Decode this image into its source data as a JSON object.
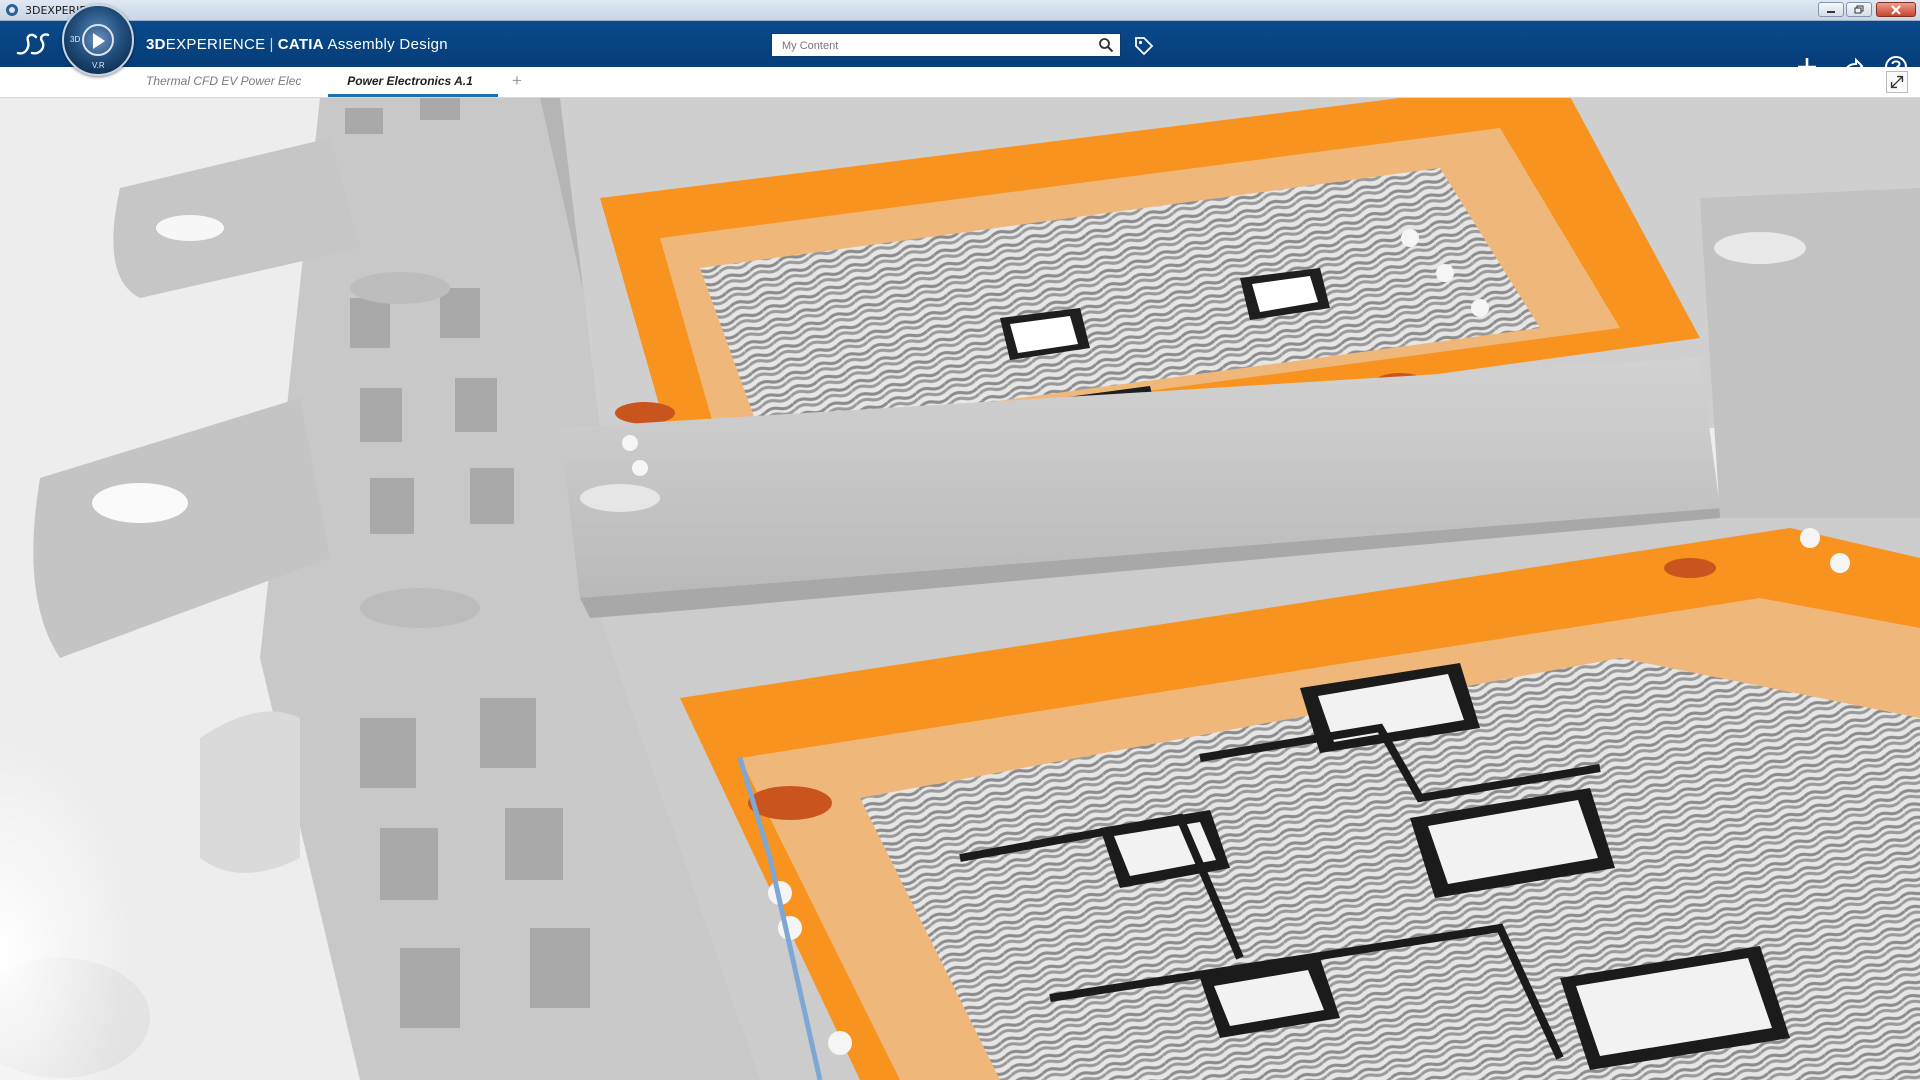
{
  "window": {
    "title": "3DEXPERIENCE",
    "controls": [
      "minimize",
      "restore",
      "close"
    ]
  },
  "header": {
    "brand_prefix": "3D",
    "brand_rest": "EXPERIENCE",
    "separator": "|",
    "product": "CATIA",
    "app_name": "Assembly Design",
    "compass_marks": [
      "3D",
      "V.R"
    ],
    "search": {
      "placeholder": "My Content",
      "value": ""
    },
    "icons": [
      "ds-logo-icon",
      "compass-icon",
      "search-icon",
      "tag-icon",
      "plus-icon",
      "share-icon",
      "help-icon"
    ]
  },
  "tabs": [
    {
      "label": "Thermal CFD EV Power Elec",
      "active": false
    },
    {
      "label": "Power Electronics A.1",
      "active": true
    }
  ],
  "add_tab_label": "+",
  "colors": {
    "accent_blue": "#0a4a8c",
    "board_orange": "#f7931e",
    "housing_gray": "#c9c9c9",
    "wire_gray": "#8f8f8f"
  }
}
